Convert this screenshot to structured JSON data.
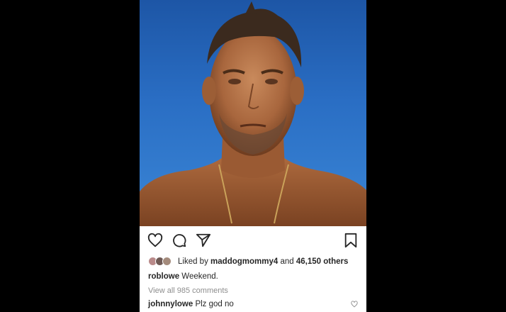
{
  "post": {
    "liked_by_prefix": "Liked by",
    "liked_by_user": "maddogmommy4",
    "liked_by_and": "and",
    "liked_by_others": "46,150 others",
    "caption_user": "roblowe",
    "caption_text": "Weekend.",
    "view_all_comments": "View all 985 comments",
    "comment_user": "johnnylowe",
    "comment_text": "Plz god no"
  },
  "icons": [
    "heart-icon",
    "comment-icon",
    "share-icon",
    "bookmark-icon",
    "comment-like-icon"
  ]
}
